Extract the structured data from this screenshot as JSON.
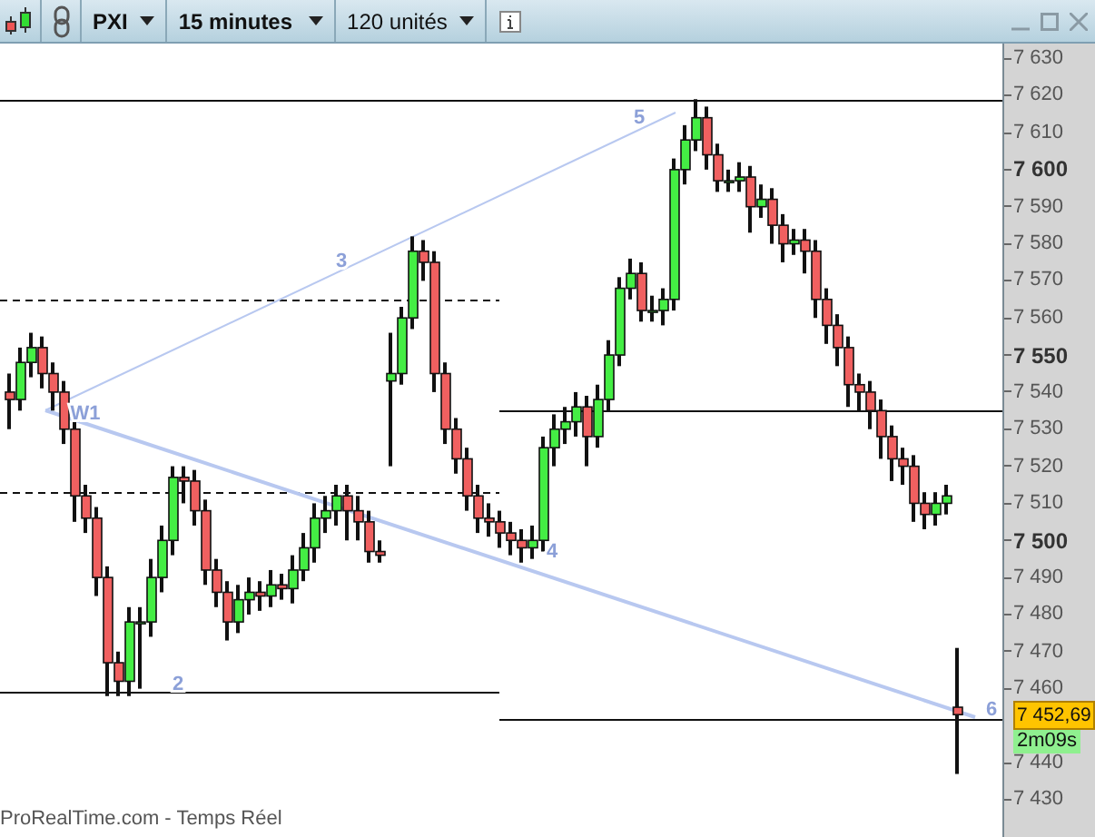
{
  "toolbar": {
    "instrument": "PXI",
    "timeframe": "15 minutes",
    "units": "120 unités"
  },
  "chart": {
    "chart_data": {
      "type": "candlestick",
      "ylim": [
        7420,
        7634
      ],
      "ohlc": [
        [
          7540,
          7545,
          7530,
          7538
        ],
        [
          7538,
          7552,
          7535,
          7548
        ],
        [
          7548,
          7556,
          7544,
          7552
        ],
        [
          7552,
          7555,
          7541,
          7545
        ],
        [
          7545,
          7548,
          7535,
          7540
        ],
        [
          7540,
          7543,
          7526,
          7530
        ],
        [
          7530,
          7533,
          7505,
          7512
        ],
        [
          7512,
          7515,
          7502,
          7506
        ],
        [
          7506,
          7509,
          7485,
          7490
        ],
        [
          7490,
          7493,
          7458,
          7467
        ],
        [
          7467,
          7470,
          7458,
          7462
        ],
        [
          7462,
          7482,
          7458,
          7478
        ],
        [
          7478,
          7482,
          7460,
          7478
        ],
        [
          7478,
          7495,
          7474,
          7490
        ],
        [
          7490,
          7504,
          7486,
          7500
        ],
        [
          7500,
          7520,
          7496,
          7517
        ],
        [
          7517,
          7520,
          7510,
          7516
        ],
        [
          7516,
          7519,
          7504,
          7508
        ],
        [
          7508,
          7511,
          7488,
          7492
        ],
        [
          7492,
          7495,
          7482,
          7486
        ],
        [
          7486,
          7489,
          7473,
          7478
        ],
        [
          7478,
          7488,
          7475,
          7484
        ],
        [
          7484,
          7490,
          7480,
          7486
        ],
        [
          7486,
          7489,
          7481,
          7485
        ],
        [
          7485,
          7492,
          7482,
          7488
        ],
        [
          7488,
          7491,
          7484,
          7487
        ],
        [
          7487,
          7496,
          7483,
          7492
        ],
        [
          7492,
          7502,
          7489,
          7498
        ],
        [
          7498,
          7510,
          7494,
          7506
        ],
        [
          7506,
          7512,
          7502,
          7508
        ],
        [
          7508,
          7515,
          7504,
          7512
        ],
        [
          7512,
          7515,
          7500,
          7508
        ],
        [
          7508,
          7512,
          7500,
          7505
        ],
        [
          7505,
          7508,
          7494,
          7497
        ],
        [
          7497,
          7500,
          7494,
          7496
        ],
        [
          7543,
          7556,
          7520,
          7545
        ],
        [
          7545,
          7563,
          7542,
          7560
        ],
        [
          7560,
          7582,
          7557,
          7578
        ],
        [
          7578,
          7581,
          7570,
          7575
        ],
        [
          7575,
          7578,
          7540,
          7545
        ],
        [
          7545,
          7548,
          7526,
          7530
        ],
        [
          7530,
          7533,
          7518,
          7522
        ],
        [
          7522,
          7525,
          7508,
          7512
        ],
        [
          7512,
          7515,
          7502,
          7506
        ],
        [
          7506,
          7510,
          7501,
          7505
        ],
        [
          7505,
          7508,
          7498,
          7502
        ],
        [
          7502,
          7505,
          7496,
          7500
        ],
        [
          7500,
          7503,
          7494,
          7498
        ],
        [
          7498,
          7504,
          7495,
          7500
        ],
        [
          7500,
          7528,
          7497,
          7525
        ],
        [
          7525,
          7534,
          7520,
          7530
        ],
        [
          7530,
          7536,
          7526,
          7532
        ],
        [
          7532,
          7540,
          7528,
          7536
        ],
        [
          7536,
          7539,
          7520,
          7528
        ],
        [
          7528,
          7542,
          7525,
          7538
        ],
        [
          7538,
          7554,
          7535,
          7550
        ],
        [
          7550,
          7571,
          7547,
          7568
        ],
        [
          7568,
          7576,
          7565,
          7572
        ],
        [
          7572,
          7575,
          7559,
          7562
        ],
        [
          7562,
          7566,
          7559,
          7562
        ],
        [
          7562,
          7568,
          7558,
          7565
        ],
        [
          7565,
          7603,
          7562,
          7600
        ],
        [
          7600,
          7612,
          7596,
          7608
        ],
        [
          7608,
          7619,
          7605,
          7614
        ],
        [
          7614,
          7617,
          7600,
          7604
        ],
        [
          7604,
          7607,
          7594,
          7597
        ],
        [
          7597,
          7600,
          7594,
          7597
        ],
        [
          7597,
          7602,
          7594,
          7598
        ],
        [
          7598,
          7601,
          7583,
          7590
        ],
        [
          7590,
          7596,
          7587,
          7592
        ],
        [
          7592,
          7595,
          7580,
          7585
        ],
        [
          7585,
          7588,
          7575,
          7580
        ],
        [
          7580,
          7584,
          7577,
          7581
        ],
        [
          7581,
          7584,
          7572,
          7578
        ],
        [
          7578,
          7581,
          7560,
          7565
        ],
        [
          7565,
          7568,
          7553,
          7558
        ],
        [
          7558,
          7561,
          7547,
          7552
        ],
        [
          7552,
          7555,
          7536,
          7542
        ],
        [
          7542,
          7545,
          7535,
          7540
        ],
        [
          7540,
          7543,
          7530,
          7535
        ],
        [
          7535,
          7538,
          7522,
          7528
        ],
        [
          7528,
          7531,
          7516,
          7522
        ],
        [
          7522,
          7525,
          7515,
          7520
        ],
        [
          7520,
          7523,
          7505,
          7510
        ],
        [
          7510,
          7513,
          7503,
          7507
        ],
        [
          7507,
          7513,
          7504,
          7510
        ],
        [
          7510,
          7515,
          7507,
          7512
        ],
        [
          7455,
          7471,
          7437,
          7453
        ]
      ],
      "yticks": [
        {
          "value": 7630,
          "label": "7 630"
        },
        {
          "value": 7620,
          "label": "7 620"
        },
        {
          "value": 7610,
          "label": "7 610"
        },
        {
          "value": 7600,
          "label": "7 600"
        },
        {
          "value": 7590,
          "label": "7 590"
        },
        {
          "value": 7580,
          "label": "7 580"
        },
        {
          "value": 7570,
          "label": "7 570"
        },
        {
          "value": 7560,
          "label": "7 560"
        },
        {
          "value": 7550,
          "label": "7 550"
        },
        {
          "value": 7540,
          "label": "7 540"
        },
        {
          "value": 7530,
          "label": "7 530"
        },
        {
          "value": 7520,
          "label": "7 520"
        },
        {
          "value": 7510,
          "label": "7 510"
        },
        {
          "value": 7500,
          "label": "7 500"
        },
        {
          "value": 7490,
          "label": "7 490"
        },
        {
          "value": 7480,
          "label": "7 480"
        },
        {
          "value": 7470,
          "label": "7 470"
        },
        {
          "value": 7460,
          "label": "7 460"
        },
        {
          "value": 7440,
          "label": "7 440"
        },
        {
          "value": 7430,
          "label": "7 430"
        }
      ]
    }
  },
  "wave_labels": [
    "W1",
    "3",
    "5",
    "2",
    "4",
    "6"
  ],
  "price_tag": "7 452,69",
  "countdown": "2m09s",
  "footer": "ProRealTime.com - Temps Réel"
}
